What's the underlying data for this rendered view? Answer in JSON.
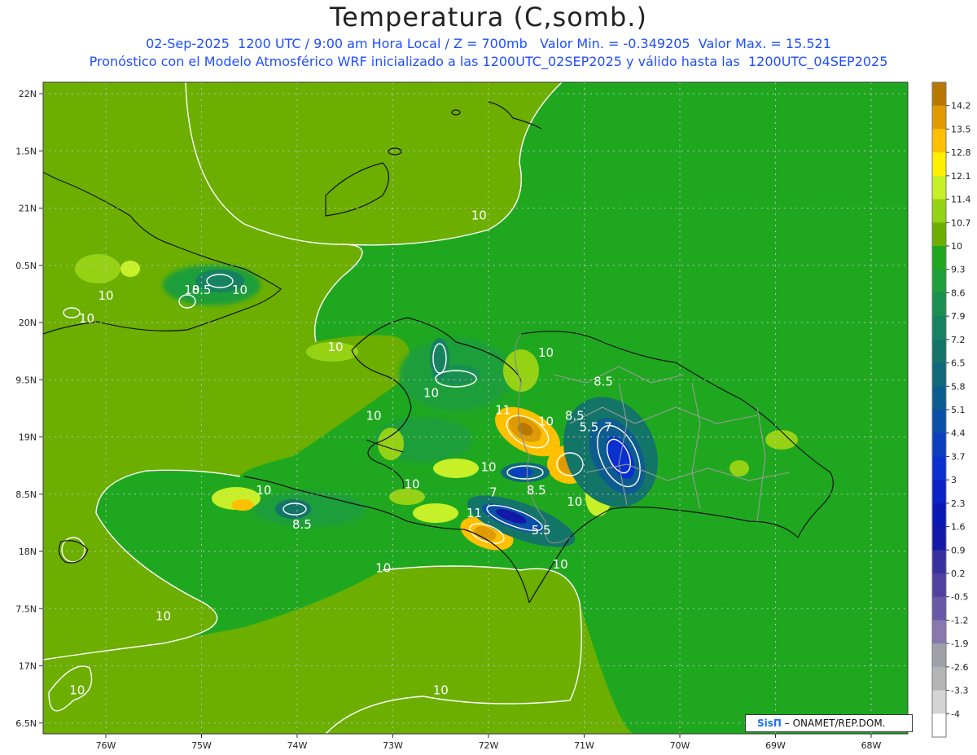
{
  "title": "Temperatura (C,somb.)",
  "subtitle1": "02-Sep-2025  1200 UTC / 9:00 am Hora Local / Z = 700mb   Valor Min. = -0.349205  Valor Max. = 15.521",
  "subtitle2": "Pronóstico con el Modelo Atmosférico WRF inicializado a las 1200UTC_02SEP2025 y válido hasta las  1200UTC_04SEP2025",
  "axes": {
    "lon_labels": [
      "76W",
      "75W",
      "74W",
      "73W",
      "72W",
      "71W",
      "70W",
      "69W",
      "68W"
    ],
    "lat_labels": [
      "22N",
      "1.5N",
      "21N",
      "0.5N",
      "20N",
      "9.5N",
      "19N",
      "8.5N",
      "18N",
      "7.5N",
      "17N",
      "6.5N"
    ]
  },
  "colorbar": {
    "labels": [
      "14.2",
      "13.5",
      "12.8",
      "12.1",
      "11.4",
      "10.7",
      "10",
      "9.3",
      "8.6",
      "7.9",
      "7.2",
      "6.5",
      "5.8",
      "5.1",
      "4.4",
      "3.7",
      "3",
      "2.3",
      "1.6",
      "0.9",
      "0.2",
      "-0.5",
      "-1.2",
      "-1.9",
      "-2.6",
      "-3.3",
      "-4"
    ],
    "colors": [
      "#b87800",
      "#e09a00",
      "#ffc000",
      "#fff000",
      "#c8f028",
      "#96d214",
      "#6caf00",
      "#1fa81f",
      "#1c9e3a",
      "#199050",
      "#168260",
      "#137468",
      "#106878",
      "#0d5c90",
      "#0b4fa8",
      "#0a3fc0",
      "#0a30d0",
      "#0a22c8",
      "#0a18b8",
      "#1418a8",
      "#3830a0",
      "#5040a0",
      "#6858a8",
      "#8878b0",
      "#a0a0a8",
      "#b4b4b4",
      "#d4d4d4",
      "#ffffff"
    ]
  },
  "contour_labels": [
    {
      "text": "10",
      "lon": -72.1,
      "lat": 20.9
    },
    {
      "text": "10",
      "lon": -73.6,
      "lat": 19.75
    },
    {
      "text": "10",
      "lon": -76.0,
      "lat": 20.2
    },
    {
      "text": "10",
      "lon": -76.2,
      "lat": 20.0
    },
    {
      "text": "8.5",
      "lon": -75.0,
      "lat": 20.25
    },
    {
      "text": "10",
      "lon": -75.1,
      "lat": 20.25
    },
    {
      "text": "10",
      "lon": -74.6,
      "lat": 20.25
    },
    {
      "text": "10",
      "lon": -71.4,
      "lat": 19.7
    },
    {
      "text": "8.5",
      "lon": -70.8,
      "lat": 19.45
    },
    {
      "text": "10",
      "lon": -72.6,
      "lat": 19.35
    },
    {
      "text": "10",
      "lon": -73.2,
      "lat": 19.15
    },
    {
      "text": "11",
      "lon": -71.85,
      "lat": 19.2
    },
    {
      "text": "10",
      "lon": -71.4,
      "lat": 19.1
    },
    {
      "text": "8.5",
      "lon": -71.1,
      "lat": 19.15
    },
    {
      "text": "5.5",
      "lon": -70.95,
      "lat": 19.05
    },
    {
      "text": "7",
      "lon": -70.75,
      "lat": 19.05
    },
    {
      "text": "10",
      "lon": -72.0,
      "lat": 18.7
    },
    {
      "text": "8.5",
      "lon": -71.5,
      "lat": 18.5
    },
    {
      "text": "10",
      "lon": -72.8,
      "lat": 18.55
    },
    {
      "text": "10",
      "lon": -74.35,
      "lat": 18.5
    },
    {
      "text": "8.5",
      "lon": -73.95,
      "lat": 18.2
    },
    {
      "text": "7",
      "lon": -71.95,
      "lat": 18.48
    },
    {
      "text": "11",
      "lon": -72.15,
      "lat": 18.3
    },
    {
      "text": "5.5",
      "lon": -71.45,
      "lat": 18.15
    },
    {
      "text": "10",
      "lon": -71.1,
      "lat": 18.4
    },
    {
      "text": "10",
      "lon": -71.25,
      "lat": 17.85
    },
    {
      "text": "10",
      "lon": -73.1,
      "lat": 17.82
    },
    {
      "text": "10",
      "lon": -75.4,
      "lat": 17.4
    },
    {
      "text": "10",
      "lon": -76.3,
      "lat": 16.75
    },
    {
      "text": "10",
      "lon": -72.5,
      "lat": 16.75
    }
  ],
  "credit": {
    "logo": "SisΠ",
    "text": "– ONAMET/REP.DOM."
  }
}
